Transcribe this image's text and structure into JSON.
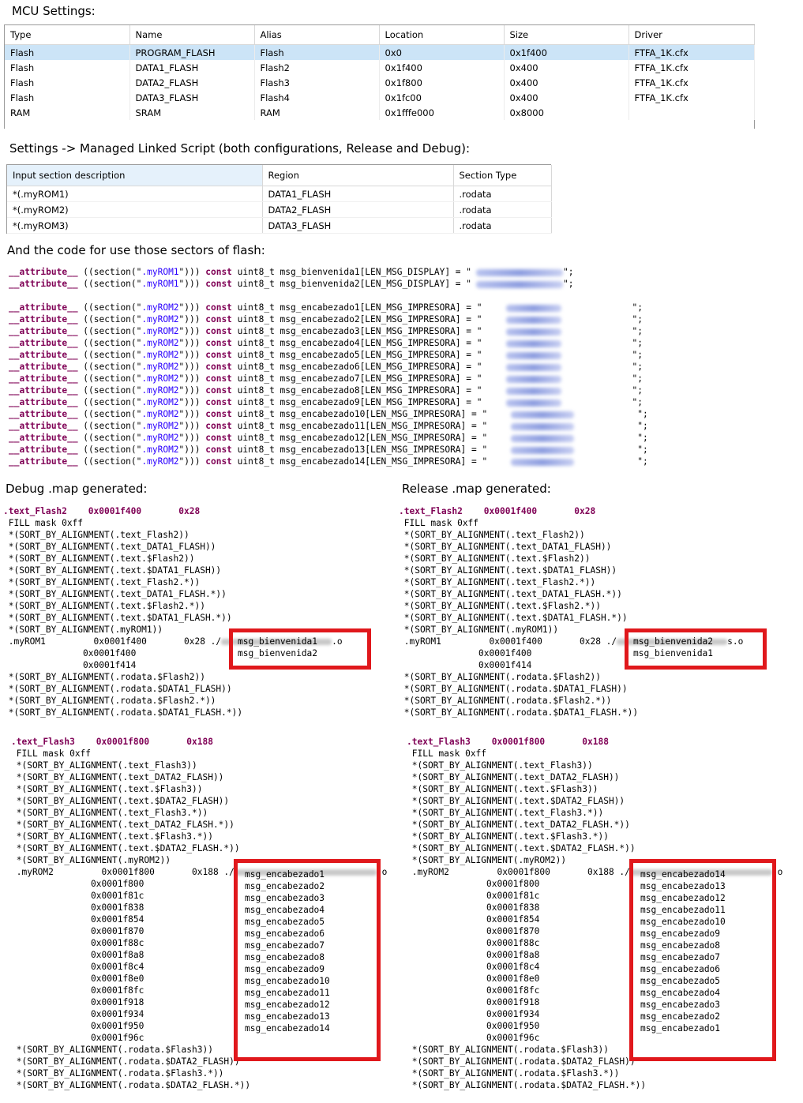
{
  "headings": {
    "mcu": "MCU Settings:",
    "linker": "Settings -> Managed Linked Script (both configurations, Release and Debug):",
    "code": "And the code for use those sectors of flash:",
    "debug": "Debug .map generated:",
    "release": "Release .map generated:"
  },
  "mcu_table": {
    "columns": [
      "Type",
      "Name",
      "Alias",
      "Location",
      "Size",
      "Driver"
    ],
    "rows": [
      [
        "Flash",
        "PROGRAM_FLASH",
        "Flash",
        "0x0",
        "0x1f400",
        "FTFA_1K.cfx"
      ],
      [
        "Flash",
        "DATA1_FLASH",
        "Flash2",
        "0x1f400",
        "0x400",
        "FTFA_1K.cfx"
      ],
      [
        "Flash",
        "DATA2_FLASH",
        "Flash3",
        "0x1f800",
        "0x400",
        "FTFA_1K.cfx"
      ],
      [
        "Flash",
        "DATA3_FLASH",
        "Flash4",
        "0x1fc00",
        "0x400",
        "FTFA_1K.cfx"
      ],
      [
        "RAM",
        "SRAM",
        "RAM",
        "0x1fffe000",
        "0x8000",
        ""
      ]
    ]
  },
  "linker_table": {
    "columns": [
      "Input section description",
      "Region",
      "Section Type"
    ],
    "rows": [
      [
        "*(.myROM1)",
        "DATA1_FLASH",
        ".rodata"
      ],
      [
        "*(.myROM2)",
        "DATA2_FLASH",
        ".rodata"
      ],
      [
        "*(.myROM3)",
        "DATA3_FLASH",
        ".rodata"
      ]
    ]
  },
  "code": {
    "attr": "__attribute__",
    "open": " ((section(\"",
    "close": "\"))) ",
    "const": "const",
    "type": " uint8_t ",
    "rom1_lines": [
      {
        "sec": ".myROM1",
        "decl": "msg_bienvenida1[LEN_MSG_DISPLAY] = "
      },
      {
        "sec": ".myROM1",
        "decl": "msg_bienvenida2[LEN_MSG_DISPLAY] = "
      }
    ],
    "rom2_lines": [
      {
        "sec": ".myROM2",
        "decl": "msg_encabezado1[LEN_MSG_IMPRESORA] = "
      },
      {
        "sec": ".myROM2",
        "decl": "msg_encabezado2[LEN_MSG_IMPRESORA] = "
      },
      {
        "sec": ".myROM2",
        "decl": "msg_encabezado3[LEN_MSG_IMPRESORA] = "
      },
      {
        "sec": ".myROM2",
        "decl": "msg_encabezado4[LEN_MSG_IMPRESORA] = "
      },
      {
        "sec": ".myROM2",
        "decl": "msg_encabezado5[LEN_MSG_IMPRESORA] = "
      },
      {
        "sec": ".myROM2",
        "decl": "msg_encabezado6[LEN_MSG_IMPRESORA] = "
      },
      {
        "sec": ".myROM2",
        "decl": "msg_encabezado7[LEN_MSG_IMPRESORA] = "
      },
      {
        "sec": ".myROM2",
        "decl": "msg_encabezado8[LEN_MSG_IMPRESORA] = "
      },
      {
        "sec": ".myROM2",
        "decl": "msg_encabezado9[LEN_MSG_IMPRESORA] = "
      },
      {
        "sec": ".myROM2",
        "decl": "msg_encabezado10[LEN_MSG_IMPRESORA] = "
      },
      {
        "sec": ".myROM2",
        "decl": "msg_encabezado11[LEN_MSG_IMPRESORA] = "
      },
      {
        "sec": ".myROM2",
        "decl": "msg_encabezado12[LEN_MSG_IMPRESORA] = "
      },
      {
        "sec": ".myROM2",
        "decl": "msg_encabezado13[LEN_MSG_IMPRESORA] = "
      },
      {
        "sec": ".myROM2",
        "decl": "msg_encabezado14[LEN_MSG_IMPRESORA] = "
      }
    ]
  },
  "maps": {
    "flash2_header": ".text_Flash2    0x0001f400       0x28",
    "flash3_header": ".text_Flash3    0x0001f800       0x188",
    "flash2_body": [
      " FILL mask 0xff",
      " *(SORT_BY_ALIGNMENT(.text_Flash2))",
      " *(SORT_BY_ALIGNMENT(.text_DATA1_FLASH))",
      " *(SORT_BY_ALIGNMENT(.text.$Flash2))",
      " *(SORT_BY_ALIGNMENT(.text.$DATA1_FLASH))",
      " *(SORT_BY_ALIGNMENT(.text_Flash2.*))",
      " *(SORT_BY_ALIGNMENT(.text_DATA1_FLASH.*))",
      " *(SORT_BY_ALIGNMENT(.text.$Flash2.*))",
      " *(SORT_BY_ALIGNMENT(.text.$DATA1_FLASH.*))",
      " *(SORT_BY_ALIGNMENT(.myROM1))"
    ],
    "flash2_rom_line": " .myROM1         0x0001f400       0x28 ./",
    "flash2_addrs": [
      "               0x0001f400",
      "               0x0001f414"
    ],
    "flash2_tail": [
      " *(SORT_BY_ALIGNMENT(.rodata.$Flash2))",
      " *(SORT_BY_ALIGNMENT(.rodata.$DATA1_FLASH))",
      " *(SORT_BY_ALIGNMENT(.rodata.$Flash2.*))",
      " *(SORT_BY_ALIGNMENT(.rodata.$DATA1_FLASH.*))"
    ],
    "flash3_body": [
      " FILL mask 0xff",
      " *(SORT_BY_ALIGNMENT(.text_Flash3))",
      " *(SORT_BY_ALIGNMENT(.text_DATA2_FLASH))",
      " *(SORT_BY_ALIGNMENT(.text.$Flash3))",
      " *(SORT_BY_ALIGNMENT(.text.$DATA2_FLASH))",
      " *(SORT_BY_ALIGNMENT(.text_Flash3.*))",
      " *(SORT_BY_ALIGNMENT(.text_DATA2_FLASH.*))",
      " *(SORT_BY_ALIGNMENT(.text.$Flash3.*))",
      " *(SORT_BY_ALIGNMENT(.text.$DATA2_FLASH.*))",
      " *(SORT_BY_ALIGNMENT(.myROM2))"
    ],
    "flash3_rom_line": " .myROM2         0x0001f800       0x188 ./",
    "flash3_addrs": [
      "0x0001f800",
      "0x0001f81c",
      "0x0001f838",
      "0x0001f854",
      "0x0001f870",
      "0x0001f88c",
      "0x0001f8a8",
      "0x0001f8c4",
      "0x0001f8e0",
      "0x0001f8fc",
      "0x0001f918",
      "0x0001f934",
      "0x0001f950",
      "0x0001f96c"
    ],
    "flash3_tail": [
      " *(SORT_BY_ALIGNMENT(.rodata.$Flash3))",
      " *(SORT_BY_ALIGNMENT(.rodata.$DATA2_FLASH))",
      " *(SORT_BY_ALIGNMENT(.rodata.$Flash3.*))",
      " *(SORT_BY_ALIGNMENT(.rodata.$DATA2_FLASH.*))"
    ],
    "debug_rom1_syms": [
      "msg_bienvenida1",
      "msg_bienvenida2"
    ],
    "release_rom1_syms": [
      "msg_bienvenida2",
      "msg_bienvenida1"
    ],
    "debug_rom2_syms": [
      "msg_encabezado1",
      "msg_encabezado2",
      "msg_encabezado3",
      "msg_encabezado4",
      "msg_encabezado5",
      "msg_encabezado6",
      "msg_encabezado7",
      "msg_encabezado8",
      "msg_encabezado9",
      "msg_encabezado10",
      "msg_encabezado11",
      "msg_encabezado12",
      "msg_encabezado13",
      "msg_encabezado14"
    ],
    "release_rom2_syms": [
      "msg_encabezado14",
      "msg_encabezado13",
      "msg_encabezado12",
      "msg_encabezado11",
      "msg_encabezado10",
      "msg_encabezado9",
      "msg_encabezado8",
      "msg_encabezado7",
      "msg_encabezado6",
      "msg_encabezado5",
      "msg_encabezado4",
      "msg_encabezado3",
      "msg_encabezado2",
      "msg_encabezado1"
    ],
    "debug_obj_suffix": ".o",
    "release_obj_suffix": "s.o",
    "release_obj_suffix2": ".o"
  },
  "colors": {
    "highlight_box": "#e0181c",
    "selected_row": "#cce4f7",
    "keyword": "#7f0055",
    "string": "#2a00ff"
  }
}
